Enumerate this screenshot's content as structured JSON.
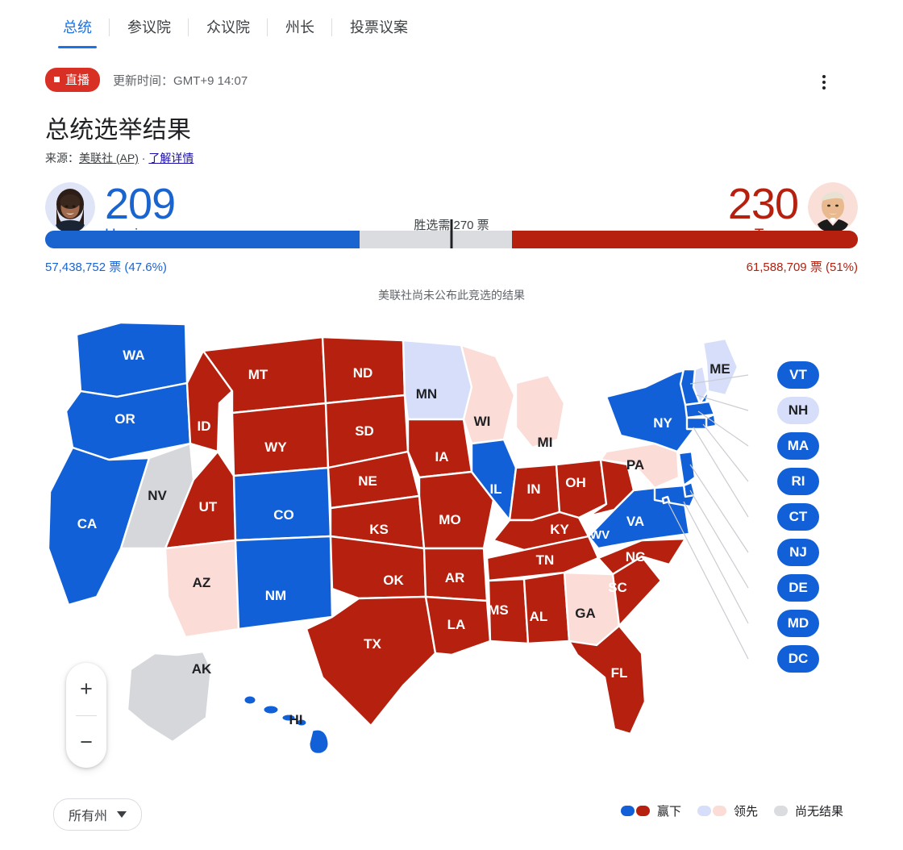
{
  "tabs": [
    {
      "label": "总统",
      "active": true
    },
    {
      "label": "参议院",
      "active": false
    },
    {
      "label": "众议院",
      "active": false
    },
    {
      "label": "州长",
      "active": false
    },
    {
      "label": "投票议案",
      "active": false
    }
  ],
  "header": {
    "live_label": "直播",
    "update_label": "更新时间：",
    "update_time": "GMT+9 14:07",
    "title": "总统选举结果",
    "source_prefix": "来源：",
    "source_name": "美联社 (AP)",
    "source_sep": " · ",
    "source_link": "了解详情",
    "menu_icon": "overflow-menu-icon"
  },
  "race": {
    "left": {
      "name": "Harris",
      "electoral": "209",
      "votes": "57,438,752 票 (47.6%)",
      "pct_bar": 38.7,
      "color": "#1a64d0"
    },
    "right": {
      "name": "Trump",
      "electoral": "230",
      "votes": "61,588,709 票 (51%)",
      "pct_bar": 42.6,
      "color": "#b5200f"
    },
    "threshold_label": "胜选需 270 票",
    "no_result_note": "美联社尚未公布此竞选的结果"
  },
  "map": {
    "zoom_in": "+",
    "zoom_out": "−",
    "pill_states": [
      {
        "code": "VT",
        "status": "win-d"
      },
      {
        "code": "NH",
        "status": "lead-d"
      },
      {
        "code": "MA",
        "status": "win-d"
      },
      {
        "code": "RI",
        "status": "win-d"
      },
      {
        "code": "CT",
        "status": "win-d"
      },
      {
        "code": "NJ",
        "status": "win-d"
      },
      {
        "code": "DE",
        "status": "win-d"
      },
      {
        "code": "MD",
        "status": "win-d"
      },
      {
        "code": "DC",
        "status": "win-d"
      }
    ]
  },
  "footer": {
    "selector_label": "所有州",
    "legend": [
      {
        "label": "赢下",
        "swatches": [
          "#1260d8",
          "#b5200f"
        ]
      },
      {
        "label": "领先",
        "swatches": [
          "#d6defa",
          "#fbdcd7"
        ]
      },
      {
        "label": "尚无结果",
        "swatches": [
          "#dadce0"
        ]
      }
    ]
  },
  "chart_data": {
    "type": "map",
    "title": "总统选举结果",
    "colors": {
      "win_dem": "#1260d8",
      "win_rep": "#b5200f",
      "lead_dem": "#d6defa",
      "lead_rep": "#fbdcd7",
      "no_result": "#d5d7da"
    },
    "states": [
      {
        "code": "WA",
        "status": "win_dem"
      },
      {
        "code": "OR",
        "status": "win_dem"
      },
      {
        "code": "CA",
        "status": "win_dem"
      },
      {
        "code": "NV",
        "status": "no_result"
      },
      {
        "code": "ID",
        "status": "win_rep"
      },
      {
        "code": "MT",
        "status": "win_rep"
      },
      {
        "code": "WY",
        "status": "win_rep"
      },
      {
        "code": "UT",
        "status": "win_rep"
      },
      {
        "code": "AZ",
        "status": "lead_rep"
      },
      {
        "code": "CO",
        "status": "win_dem"
      },
      {
        "code": "NM",
        "status": "win_dem"
      },
      {
        "code": "ND",
        "status": "win_rep"
      },
      {
        "code": "SD",
        "status": "win_rep"
      },
      {
        "code": "NE",
        "status": "win_rep"
      },
      {
        "code": "KS",
        "status": "win_rep"
      },
      {
        "code": "OK",
        "status": "win_rep"
      },
      {
        "code": "TX",
        "status": "win_rep"
      },
      {
        "code": "MN",
        "status": "lead_dem"
      },
      {
        "code": "IA",
        "status": "win_rep"
      },
      {
        "code": "MO",
        "status": "win_rep"
      },
      {
        "code": "AR",
        "status": "win_rep"
      },
      {
        "code": "LA",
        "status": "win_rep"
      },
      {
        "code": "WI",
        "status": "lead_rep"
      },
      {
        "code": "IL",
        "status": "win_dem"
      },
      {
        "code": "MI",
        "status": "lead_rep"
      },
      {
        "code": "IN",
        "status": "win_rep"
      },
      {
        "code": "OH",
        "status": "win_rep"
      },
      {
        "code": "KY",
        "status": "win_rep"
      },
      {
        "code": "TN",
        "status": "win_rep"
      },
      {
        "code": "MS",
        "status": "win_rep"
      },
      {
        "code": "AL",
        "status": "win_rep"
      },
      {
        "code": "GA",
        "status": "lead_rep"
      },
      {
        "code": "FL",
        "status": "win_rep"
      },
      {
        "code": "SC",
        "status": "win_rep"
      },
      {
        "code": "NC",
        "status": "win_rep"
      },
      {
        "code": "VA",
        "status": "win_dem"
      },
      {
        "code": "WV",
        "status": "win_rep"
      },
      {
        "code": "PA",
        "status": "lead_rep"
      },
      {
        "code": "NY",
        "status": "win_dem"
      },
      {
        "code": "ME",
        "status": "lead_dem"
      },
      {
        "code": "VT",
        "status": "win_dem"
      },
      {
        "code": "NH",
        "status": "lead_dem"
      },
      {
        "code": "MA",
        "status": "win_dem"
      },
      {
        "code": "RI",
        "status": "win_dem"
      },
      {
        "code": "CT",
        "status": "win_dem"
      },
      {
        "code": "NJ",
        "status": "win_dem"
      },
      {
        "code": "DE",
        "status": "win_dem"
      },
      {
        "code": "MD",
        "status": "win_dem"
      },
      {
        "code": "DC",
        "status": "win_dem"
      },
      {
        "code": "AK",
        "status": "no_result"
      },
      {
        "code": "HI",
        "status": "win_dem"
      }
    ],
    "electoral_votes": {
      "Harris": 209,
      "Trump": 230,
      "needed": 270
    },
    "popular_votes": {
      "Harris": 57438752,
      "Trump": 61588709
    },
    "popular_pct": {
      "Harris": 47.6,
      "Trump": 51.0
    }
  }
}
